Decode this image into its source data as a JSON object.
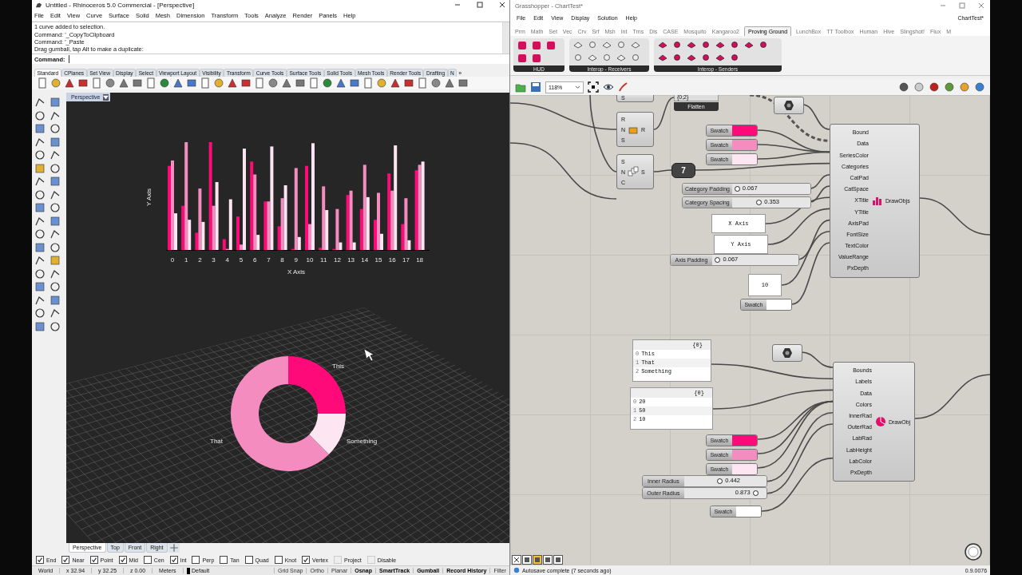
{
  "rhino": {
    "title": "Untitled - Rhinoceros 5.0 Commercial - [Perspective]",
    "menu": [
      "File",
      "Edit",
      "View",
      "Curve",
      "Surface",
      "Solid",
      "Mesh",
      "Dimension",
      "Transform",
      "Tools",
      "Analyze",
      "Render",
      "Panels",
      "Help"
    ],
    "command_history": [
      "1 curve added to selection.",
      "Command: '_CopyToClipboard",
      "Command: '_Paste",
      "Drag gumball, tap Alt to make a duplicate:"
    ],
    "command_label": "Command:",
    "toolbar_tabs": [
      {
        "label": "Standard",
        "selected": true
      },
      {
        "label": "CPlanes",
        "selected": false
      },
      {
        "label": "Set View",
        "selected": false
      },
      {
        "label": "Display",
        "selected": false
      },
      {
        "label": "Select",
        "selected": false
      },
      {
        "label": "Viewport Layout",
        "selected": false
      },
      {
        "label": "Visibility",
        "selected": false
      },
      {
        "label": "Transform",
        "selected": false
      },
      {
        "label": "Curve Tools",
        "selected": false
      },
      {
        "label": "Surface Tools",
        "selected": false
      },
      {
        "label": "Solid Tools",
        "selected": false
      },
      {
        "label": "Mesh Tools",
        "selected": false
      },
      {
        "label": "Render Tools",
        "selected": false
      },
      {
        "label": "Drafting",
        "selected": false
      },
      {
        "label": "N",
        "selected": false
      }
    ],
    "tabs_overflow": "»",
    "viewport": {
      "label": "Perspective",
      "x_labels": [
        "0",
        "1",
        "2",
        "3",
        "4",
        "5",
        "6",
        "7",
        "8",
        "9",
        "10",
        "11",
        "12",
        "13",
        "14",
        "15",
        "16",
        "17",
        "18"
      ],
      "x_title": "X Axis",
      "y_title": "Y Axis",
      "donut_labels": [
        "This",
        "That",
        "Something"
      ]
    },
    "view_tabs": [
      {
        "label": "Perspective",
        "selected": true
      },
      {
        "label": "Top",
        "selected": false
      },
      {
        "label": "Front",
        "selected": false
      },
      {
        "label": "Right",
        "selected": false
      }
    ],
    "osnaps": [
      {
        "label": "End",
        "checked": true,
        "kind": "snap"
      },
      {
        "label": "Near",
        "checked": true,
        "kind": "snap"
      },
      {
        "label": "Point",
        "checked": true,
        "kind": "snap"
      },
      {
        "label": "Mid",
        "checked": true,
        "kind": "snap"
      },
      {
        "label": "Cen",
        "checked": false,
        "kind": "snap"
      },
      {
        "label": "Int",
        "checked": true,
        "kind": "snap"
      },
      {
        "label": "Perp",
        "checked": false,
        "kind": "snap"
      },
      {
        "label": "Tan",
        "checked": false,
        "kind": "snap"
      },
      {
        "label": "Quad",
        "checked": false,
        "kind": "snap"
      },
      {
        "label": "Knot",
        "checked": false,
        "kind": "snap"
      },
      {
        "label": "Vertex",
        "checked": true,
        "kind": "snap"
      },
      {
        "label": "Project",
        "checked": false,
        "kind": "mode"
      },
      {
        "label": "Disable",
        "checked": false,
        "kind": "mode"
      }
    ],
    "coordinates": [
      "World",
      "x 32.94",
      "y 32.25",
      "z 0.00",
      "Meters"
    ],
    "layer": "Default",
    "toggles": [
      {
        "label": "Grid Snap",
        "on": false
      },
      {
        "label": "Ortho",
        "on": false
      },
      {
        "label": "Planar",
        "on": false
      },
      {
        "label": "Osnap",
        "on": true
      },
      {
        "label": "SmartTrack",
        "on": true
      },
      {
        "label": "Gumball",
        "on": true
      },
      {
        "label": "Record History",
        "on": true
      },
      {
        "label": "Filter",
        "on": false
      }
    ]
  },
  "grasshopper": {
    "title": "Grasshopper - ChartTest*",
    "menu": [
      "File",
      "Edit",
      "View",
      "Display",
      "Solution",
      "Help"
    ],
    "doc": "ChartTest*",
    "tabs": [
      {
        "label": "Prm",
        "selected": false
      },
      {
        "label": "Math",
        "selected": false
      },
      {
        "label": "Set",
        "selected": false
      },
      {
        "label": "Vec",
        "selected": false
      },
      {
        "label": "Crv",
        "selected": false
      },
      {
        "label": "Srf",
        "selected": false
      },
      {
        "label": "Msh",
        "selected": false
      },
      {
        "label": "Int",
        "selected": false
      },
      {
        "label": "Trns",
        "selected": false
      },
      {
        "label": "Dis",
        "selected": false
      },
      {
        "label": "CASE",
        "selected": false
      },
      {
        "label": "Mosquito",
        "selected": false
      },
      {
        "label": "Kangaroo2",
        "selected": false
      },
      {
        "label": "Proving Ground",
        "selected": true
      },
      {
        "label": "LunchBox",
        "selected": false
      },
      {
        "label": "TT Toolbox",
        "selected": false
      },
      {
        "label": "Human",
        "selected": false
      },
      {
        "label": "Hive",
        "selected": false
      },
      {
        "label": "Slingshot!",
        "selected": false
      },
      {
        "label": "Flux",
        "selected": false
      },
      {
        "label": "M",
        "selected": false
      }
    ],
    "ribbon_groups": [
      "HUD",
      "Interop - Receivers",
      "Interop - Senders"
    ],
    "zoom": "118%",
    "canvas": {
      "partial_inputs": [
        "S"
      ],
      "flatten_panel": "{0;2}",
      "flatten_label": "Flatten",
      "components": [
        {
          "inputs": [
            "R",
            "N",
            "S"
          ],
          "output": "R"
        },
        {
          "inputs": [
            "S",
            "N",
            "C"
          ],
          "output": "S"
        }
      ],
      "number_badge": "7",
      "swatches": [
        {
          "label": "Swatch",
          "color": "#ff0a78"
        },
        {
          "label": "Swatch",
          "color": "#f48cc0"
        },
        {
          "label": "Swatch",
          "color": "#fde6f2"
        },
        {
          "label": "Swatch",
          "color": "#ffffff"
        },
        {
          "label": "Swatch",
          "color": "#ff0a78"
        },
        {
          "label": "Swatch",
          "color": "#f48cc0"
        },
        {
          "label": "Swatch",
          "color": "#fde6f2"
        },
        {
          "label": "Swatch",
          "color": "#ffffff"
        }
      ],
      "sliders": [
        {
          "label": "Category Padding",
          "value": "0.067",
          "level": 0.07
        },
        {
          "label": "Category Spacing",
          "value": "0.353",
          "level": 0.35
        },
        {
          "label": "Axis Padding",
          "value": "0.067",
          "level": 0.07
        },
        {
          "label": "Inner Radius",
          "value": "0.442",
          "level": 0.44
        },
        {
          "label": "Outer Radius",
          "value": "0.873",
          "level": 0.87
        }
      ],
      "text_panels": [
        "X Axis",
        "Y Axis",
        "10"
      ],
      "list_panels": [
        {
          "header": "{0}",
          "items": [
            {
              "index": "0",
              "text": "This"
            },
            {
              "index": "1",
              "text": "That"
            },
            {
              "index": "2",
              "text": "Something"
            }
          ]
        },
        {
          "header": "{0}",
          "items": [
            {
              "index": "0",
              "text": "20"
            },
            {
              "index": "1",
              "text": "50"
            },
            {
              "index": "2",
              "text": "10"
            }
          ]
        }
      ],
      "chart_components": [
        {
          "inputs": [
            "Bound",
            "Data",
            "SeriesColor",
            "Categories",
            "CatPad",
            "CatSpace",
            "XTitle",
            "YTitle",
            "AxisPad",
            "FontSize",
            "TextColor",
            "ValueRange",
            "PxDepth"
          ],
          "output": "DrawObjs",
          "kind": "bar"
        },
        {
          "inputs": [
            "Bounds",
            "Labels",
            "Data",
            "Colors",
            "InnerRad",
            "OuterRad",
            "LabRad",
            "LabHeight",
            "LabColor",
            "PxDepth"
          ],
          "output": "DrawObj",
          "kind": "pie"
        }
      ]
    },
    "status": "Autosave complete (7 seconds ago)",
    "version": "0.9.0076"
  }
}
